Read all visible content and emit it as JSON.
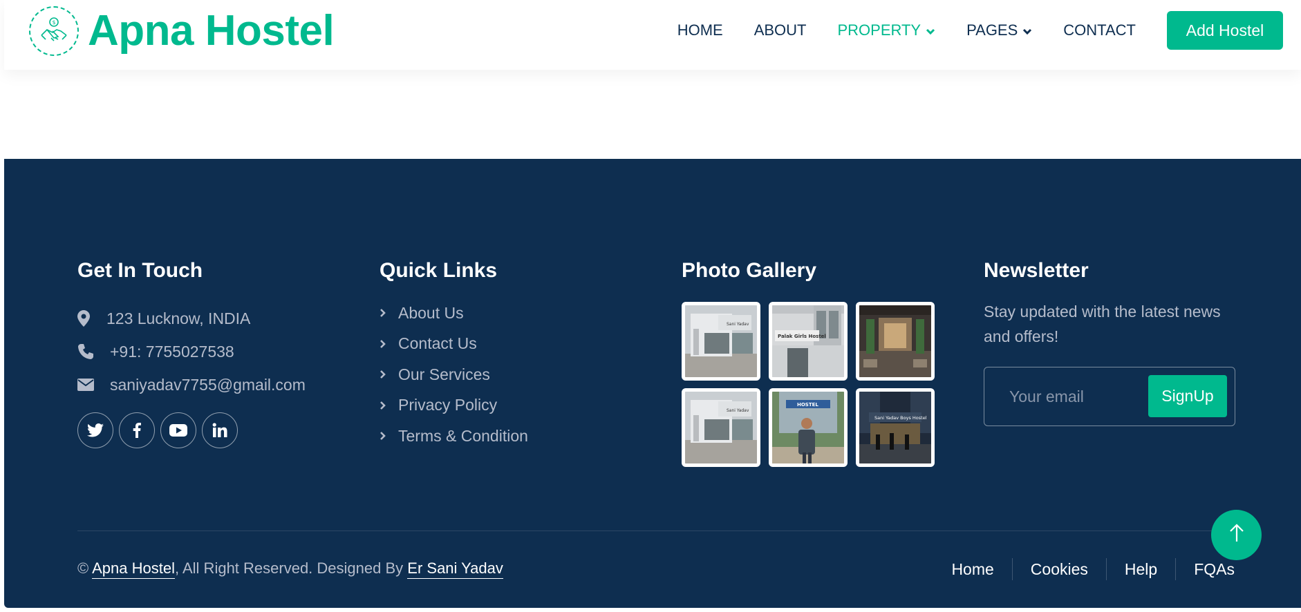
{
  "brand": {
    "name": "Apna Hostel",
    "accent_color": "#00b98e",
    "navy_color": "#0e2e50"
  },
  "nav": {
    "items": [
      {
        "label": "HOME"
      },
      {
        "label": "ABOUT"
      },
      {
        "label": "PROPERTY",
        "active": true,
        "dropdown": true
      },
      {
        "label": "PAGES",
        "dropdown": true
      },
      {
        "label": "CONTACT"
      }
    ],
    "cta_label": "Add Hostel"
  },
  "footer": {
    "contact": {
      "title": "Get In Touch",
      "address": "123 Lucknow, INDIA",
      "phone": "+91: 7755027538",
      "email": "saniyadav7755@gmail.com",
      "socials": [
        "twitter-icon",
        "facebook-icon",
        "youtube-icon",
        "linkedin-icon"
      ]
    },
    "quick_links": {
      "title": "Quick Links",
      "items": [
        "About Us",
        "Contact Us",
        "Our Services",
        "Privacy Policy",
        "Terms & Condition"
      ]
    },
    "gallery": {
      "title": "Photo Gallery",
      "images": [
        {
          "sign": "Sani Yadav"
        },
        {
          "sign": "Palak Girls Hostel"
        },
        {
          "sign": ""
        },
        {
          "sign": "Sani Yadav"
        },
        {
          "sign": "HOSTEL"
        },
        {
          "sign": "Sani Yadav Boys Hostel"
        }
      ]
    },
    "newsletter": {
      "title": "Newsletter",
      "text": "Stay updated with the latest news and offers!",
      "placeholder": "Your email",
      "button_label": "SignUp"
    },
    "copyright": {
      "prefix": "©",
      "site": "Apna Hostel",
      "middle": ", All Right Reserved. Designed By",
      "designer": "Er Sani Yadav"
    },
    "bottom_nav": [
      "Home",
      "Cookies",
      "Help",
      "FQAs"
    ]
  }
}
